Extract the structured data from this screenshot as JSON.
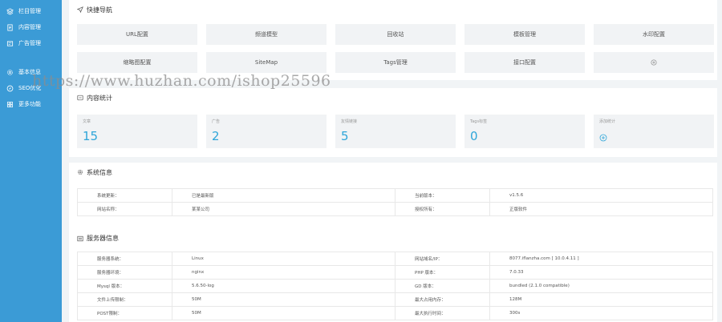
{
  "sidebar": {
    "items": [
      {
        "label": "栏目管理",
        "icon": "layers-icon"
      },
      {
        "label": "内容管理",
        "icon": "document-icon"
      },
      {
        "label": "广告管理",
        "icon": "ad-icon"
      },
      {
        "label": "基本信息",
        "icon": "gear-icon"
      },
      {
        "label": "SEO优化",
        "icon": "compass-icon"
      },
      {
        "label": "更多功能",
        "icon": "grid-icon"
      }
    ]
  },
  "quick_nav": {
    "title": "快捷导航",
    "buttons": [
      "URL配置",
      "频道模型",
      "回收站",
      "模板管理",
      "水印配置",
      "缩略图配置",
      "SiteMap",
      "Tags管理",
      "接口配置"
    ]
  },
  "content_stats": {
    "title": "内容统计",
    "items": [
      {
        "label": "文章",
        "value": "15"
      },
      {
        "label": "广告",
        "value": "2"
      },
      {
        "label": "友情链接",
        "value": "5"
      },
      {
        "label": "Tags标签",
        "value": "0"
      }
    ],
    "add_label": "添加统计"
  },
  "system_info": {
    "title": "系统信息",
    "rows": [
      [
        "系统更新：",
        "已是最新版",
        "当前版本：",
        "v1.5.6"
      ],
      [
        "网站名称：",
        "某某公司",
        "授权所有：",
        "正版软件"
      ]
    ]
  },
  "server_info": {
    "title": "服务器信息",
    "rows": [
      [
        "服务器系统：",
        "Linux",
        "网站域名/IP：",
        "8077.iflanzha.com [ 10.0.4.11 ]"
      ],
      [
        "服务器环境：",
        "nginx",
        "PHP 版本：",
        "7.0.33"
      ],
      [
        "Mysql 版本：",
        "5.6.50-log",
        "GD 版本：",
        "bundled (2.1.0 compatible)"
      ],
      [
        "文件上传限制：",
        "50M",
        "最大占用内存：",
        "128M"
      ],
      [
        "POST限制：",
        "50M",
        "最大执行时间：",
        "300s"
      ]
    ]
  },
  "watermark": "https://www.huzhan.com/ishop25596",
  "colors": {
    "sidebar": "#3b9bd6",
    "accent": "#2ea6d9",
    "background": "#f1f4f6"
  }
}
